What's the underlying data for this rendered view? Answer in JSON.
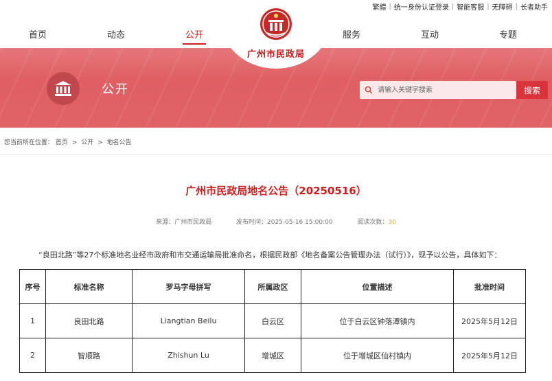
{
  "toplinks": [
    "繁體",
    "统一身份认证登录",
    "智能客服",
    "无障碍",
    "长者助手"
  ],
  "nav": {
    "left": [
      "首页",
      "动态",
      "公开"
    ],
    "right": [
      "服务",
      "互动",
      "专题"
    ],
    "active": "公开"
  },
  "logo": {
    "title": "广州市民政局"
  },
  "banner": {
    "section_title": "公开",
    "search_placeholder": "请输入关键字搜索",
    "search_button": "搜索"
  },
  "breadcrumb": {
    "prefix": "您当前所在位置：",
    "items": [
      "首页",
      "公开",
      "地名公告"
    ]
  },
  "article": {
    "title": "广州市民政局地名公告（20250516）",
    "source_label": "来源：",
    "source": "广州市民政局",
    "date_label": "发布时间：",
    "date": "2025-05-16 15:00:00",
    "views_label": "阅读次数：",
    "views": "30",
    "intro": "“良田北路”等27个标准地名业经市政府和市交通运输局批准命名，根据民政部《地名备案公告管理办法（试行）》，现予以公告，具体如下："
  },
  "table": {
    "headers": [
      "序号",
      "标准名称",
      "罗马字母拼写",
      "所属政区",
      "位置描述",
      "批准时间"
    ],
    "rows": [
      [
        "1",
        "良田北路",
        "Liangtian Beilu",
        "白云区",
        "位于白云区钟落潭镇内",
        "2025年5月12日"
      ],
      [
        "2",
        "智顺路",
        "Zhishun Lu",
        "增城区",
        "位于增城区仙村镇内",
        "2025年5月12日"
      ]
    ]
  },
  "colors": {
    "accent": "#c81f1f",
    "banner": "#df5f63",
    "search_button": "#d9343b",
    "views": "#e0a33c"
  },
  "icons": {
    "section": "government-building-icon",
    "search": "search-icon",
    "logo": "emblem-logo-icon"
  }
}
